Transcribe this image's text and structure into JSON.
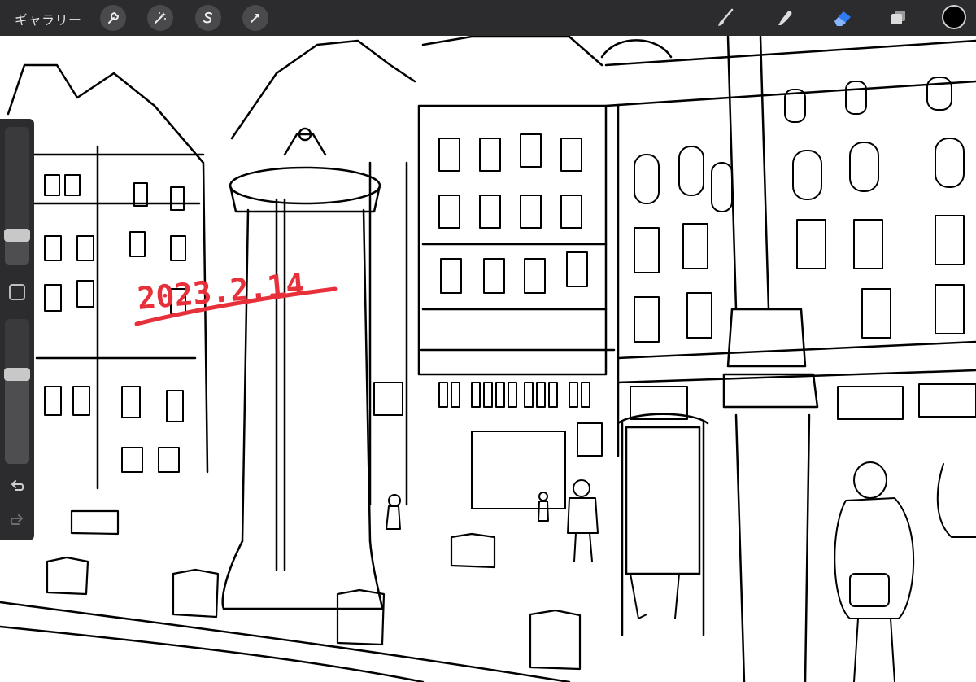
{
  "toolbar": {
    "gallery_label": "ギャラリー",
    "actions": [
      "wrench-icon",
      "magic-wand-icon",
      "selection-s-icon",
      "transform-arrow-icon"
    ],
    "tools": [
      "brush-icon",
      "smudge-icon",
      "eraser-icon",
      "layers-icon"
    ],
    "active_tool": "eraser-icon",
    "current_color": "#000000",
    "active_color": "#2f7bf6"
  },
  "canvas": {
    "handwritten_date": "2023.2.14",
    "ink_color": "#e8303a"
  },
  "sidebar": {
    "brush_size": 0.22,
    "opacity": 0.62,
    "undo_enabled": true,
    "redo_enabled": false
  }
}
